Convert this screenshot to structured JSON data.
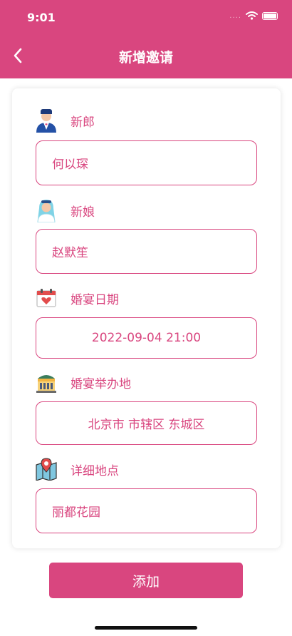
{
  "status_bar": {
    "time": "9:01",
    "signal": "....",
    "wifi_icon": "wifi-icon",
    "battery_icon": "battery-icon"
  },
  "nav": {
    "back_icon": "chevron-left-icon",
    "title": "新增邀请"
  },
  "form": {
    "groom": {
      "label": "新郎",
      "value": "何以琛",
      "icon": "groom-icon"
    },
    "bride": {
      "label": "新娘",
      "value": "赵默笙",
      "icon": "bride-icon"
    },
    "date": {
      "label": "婚宴日期",
      "value": "2022-09-04 21:00",
      "icon": "calendar-icon"
    },
    "venue_region": {
      "label": "婚宴举办地",
      "value": "北京市 市辖区 东城区",
      "icon": "building-icon"
    },
    "address": {
      "label": "详细地点",
      "value": "丽都花园",
      "icon": "map-pin-icon"
    }
  },
  "actions": {
    "add_label": "添加"
  },
  "colors": {
    "accent": "#d9467f",
    "background": "#ffffff"
  }
}
